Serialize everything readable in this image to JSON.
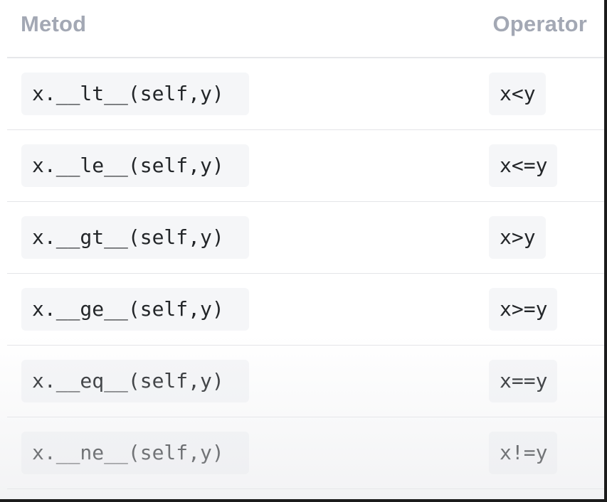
{
  "table": {
    "headers": {
      "method": "Metod",
      "operator": "Operator"
    },
    "rows": [
      {
        "method": "x.__lt__(self,y)",
        "operator": "x<y"
      },
      {
        "method": "x.__le__(self,y)",
        "operator": "x<=y"
      },
      {
        "method": "x.__gt__(self,y)",
        "operator": "x>y"
      },
      {
        "method": "x.__ge__(self,y)",
        "operator": "x>=y"
      },
      {
        "method": "x.__eq__(self,y)",
        "operator": "x==y"
      },
      {
        "method": "x.__ne__(self,y)",
        "operator": "x!=y"
      }
    ]
  }
}
